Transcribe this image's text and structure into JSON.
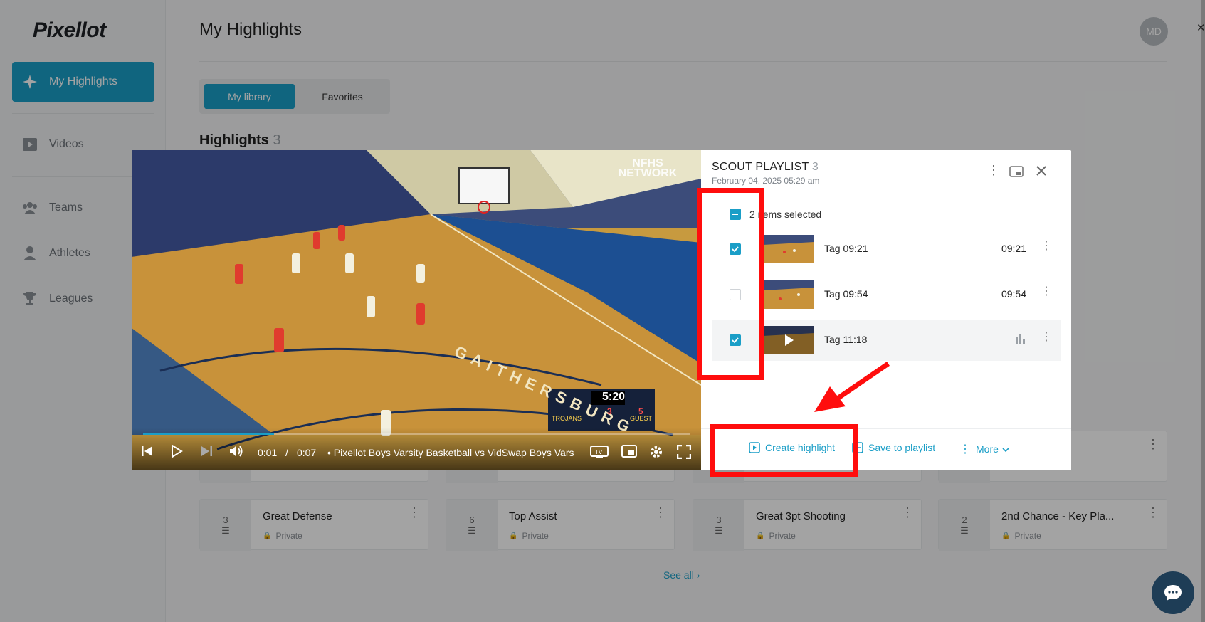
{
  "app": {
    "logo_text": "Pixellot",
    "page_title": "My Highlights",
    "avatar_initials": "MD",
    "accent_color": "#1a9ec7"
  },
  "sidebar": {
    "items": [
      {
        "label": "My Highlights",
        "icon": "sparkle-icon",
        "active": true
      },
      {
        "label": "Videos",
        "icon": "video-icon"
      },
      {
        "label": "Teams",
        "icon": "teams-icon"
      },
      {
        "label": "Athletes",
        "icon": "athlete-icon"
      },
      {
        "label": "Leagues",
        "icon": "trophy-icon"
      }
    ]
  },
  "library": {
    "tabs": [
      "My library",
      "Favorites"
    ],
    "active_tab": "My library",
    "heading": "Highlights",
    "heading_count": "3",
    "cards": [
      {
        "count": "3",
        "name": "Great Defense",
        "visibility": "Private"
      },
      {
        "count": "6",
        "name": "Top Assist",
        "visibility": "Private"
      },
      {
        "count": "3",
        "name": "Great 3pt Shooting",
        "visibility": "Private"
      },
      {
        "count": "2",
        "name": "2nd Chance - Key Pla...",
        "visibility": "Private"
      }
    ],
    "see_all": "See all"
  },
  "player": {
    "current_time": "0:01",
    "separator": "/",
    "duration": "0:07",
    "title": "• Pixellot Boys Varsity Basketball vs VidSwap Boys Vars",
    "progress_fraction": 0.24,
    "watermark": "NFHS NETWORK",
    "court_text": "GAITHERSBURG",
    "scoreboard": {
      "clock": "5:20",
      "home": "TROJANS",
      "away": "GUEST",
      "home_score": "3",
      "away_score": "5"
    }
  },
  "playlist": {
    "title": "SCOUT PLAYLIST",
    "count": "3",
    "date": "February 04, 2025 05:29 am",
    "selection_text": "2 items selected",
    "clips": [
      {
        "name": "Tag 09:21",
        "time": "09:21",
        "checked": true
      },
      {
        "name": "Tag 09:54",
        "time": "09:54",
        "checked": false
      },
      {
        "name": "Tag 11:18",
        "time": "",
        "checked": true,
        "playing": true
      }
    ],
    "actions": {
      "create": "Create highlight",
      "save": "Save to playlist",
      "more": "More"
    }
  },
  "annotation_color": "#ff0d0d"
}
